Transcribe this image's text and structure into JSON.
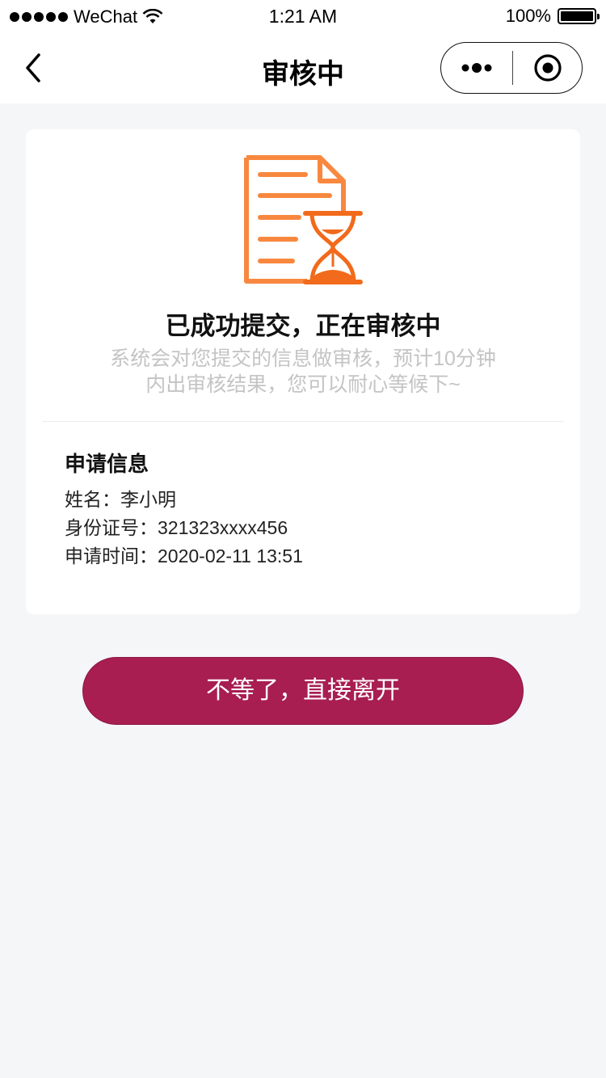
{
  "status_bar": {
    "carrier": "WeChat",
    "time": "1:21 AM",
    "battery": "100%"
  },
  "nav": {
    "title": "审核中",
    "back_icon": "chevron-left-icon",
    "more_icon": "more-dots-icon",
    "close_icon": "target-circle-icon"
  },
  "card": {
    "illustration_icon": "document-hourglass-icon",
    "headline": "已成功提交，正在审核中",
    "desc_line1": "系统会对您提交的信息做审核，预计10分钟",
    "desc_line2": "内出审核结果，您可以耐心等候下~",
    "info": {
      "title": "申请信息",
      "name_row": "姓名：李小明",
      "id_row": "身份证号：321323xxxx456",
      "time_row": "申请时间：2020-02-11 13:51"
    }
  },
  "leave_button": "不等了，直接离开",
  "colors": {
    "accent": "#a81e50",
    "illustration_orange": "#f57c3b",
    "background": "#f5f6f8"
  }
}
